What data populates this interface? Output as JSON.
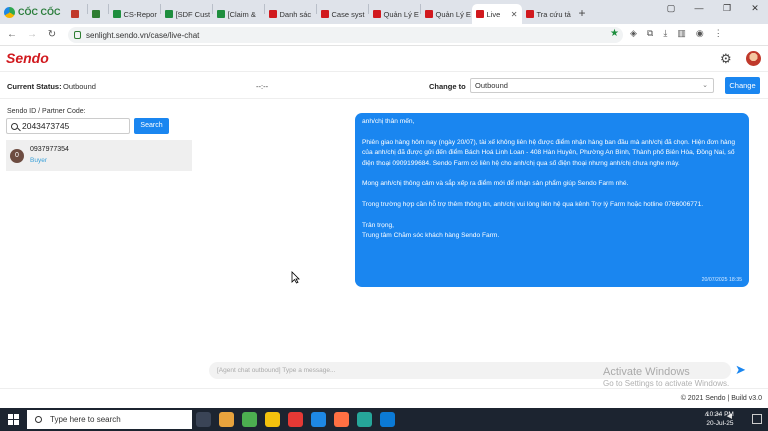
{
  "browser": {
    "brand": "CỐC CỐC",
    "tabs": [
      {
        "label": "",
        "color": "#c0392b"
      },
      {
        "label": "",
        "color": "#2e7d32"
      },
      {
        "label": "CS-Repor",
        "color": "#1e8e3e"
      },
      {
        "label": "[SDF Cust",
        "color": "#1e8e3e"
      },
      {
        "label": "[Claim &",
        "color": "#1e8e3e"
      },
      {
        "label": "Danh sác",
        "color": "#d1191e"
      },
      {
        "label": "Case syst",
        "color": "#d1191e"
      },
      {
        "label": "Quản Lý E",
        "color": "#d1191e"
      },
      {
        "label": "Quản Lý E",
        "color": "#d1191e"
      },
      {
        "label": "Live",
        "color": "#d1191e",
        "active": true
      },
      {
        "label": "Tra cứu tả",
        "color": "#d1191e"
      }
    ],
    "url": "senlight.sendo.vn/case/live-chat"
  },
  "app": {
    "logo": "Sendo"
  },
  "status": {
    "label": "Current Status:",
    "value": "Outbound",
    "timer": "--:--",
    "change_to_label": "Change to",
    "change_to_value": "Outbound",
    "change_button": "Change"
  },
  "left_panel": {
    "label": "Sendo ID / Partner Code:",
    "search_value": "2043473745",
    "search_button": "Search",
    "conversation": {
      "avatar_letter": "0",
      "phone": "0937977354",
      "role": "Buyer"
    }
  },
  "chat": {
    "message": {
      "greeting": "anh/chị thân mến,",
      "para1": "Phiên giao hàng hôm nay (ngày 20/07), tài xế không liên hệ được điểm nhận hàng ban đầu mà anh/chị đã chọn. Hiện đơn hàng của anh/chị đã được gửi đến điểm Bách Hoá Linh Loan - 408 Hàn Huyên, Phường An Bình, Thành phố Biên Hòa, Đồng Nai, số điện thoại 0909199684. Sendo Farm có liên hệ cho anh/chị qua số điện thoại nhưng anh/chị chưa nghe máy.",
      "para2": "Mong anh/chị thông cảm và sắp xếp ra điểm mới để nhận sản phẩm giúp Sendo Farm nhé.",
      "para3": "Trong trường hợp cần hỗ trợ thêm thông tin, anh/chị vui lòng liên hệ qua kênh Trợ lý Farm hoặc hotline 0766006771.",
      "closing": "Trân trọng,",
      "signature": "Trung tâm Chăm sóc khách hàng Sendo Farm.",
      "timestamp": "20/07/2025 18:35"
    },
    "input_placeholder": "[Agent chat outbound] Type a message...",
    "watermark_title": "Activate Windows",
    "watermark_sub": "Go to Settings to activate Windows."
  },
  "footer": {
    "text": "© 2021 Sendo | Build v3.0"
  },
  "taskbar": {
    "search_placeholder": "Type here to search",
    "time": "10:34 PM",
    "date": "20-Jul-25"
  }
}
